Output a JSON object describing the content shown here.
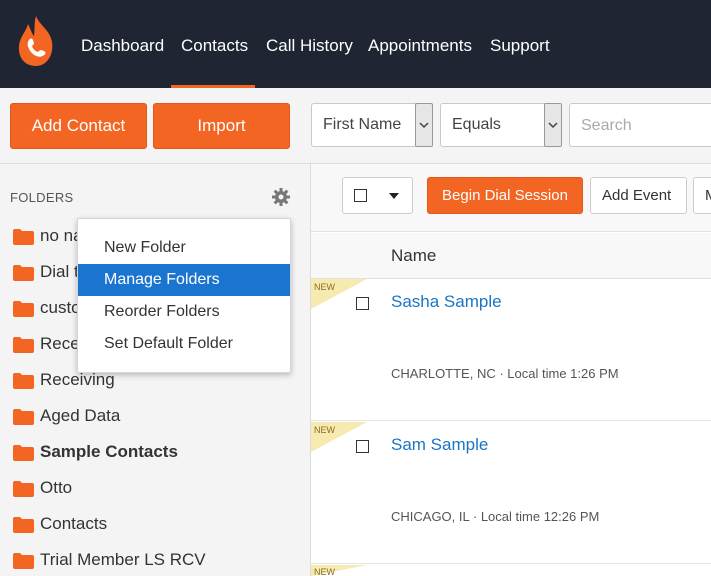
{
  "nav": {
    "items": [
      "Dashboard",
      "Contacts",
      "Call History",
      "Appointments",
      "Support"
    ],
    "active": "Contacts"
  },
  "actions": {
    "add_contact": "Add Contact",
    "import": "Import"
  },
  "filters": {
    "field": "First Name",
    "operator": "Equals",
    "search_placeholder": "Search"
  },
  "sidebar": {
    "title": "FOLDERS",
    "folders": [
      "no na",
      "Dial t",
      "custo",
      "Rece",
      "Receiving",
      "Aged Data",
      "Sample Contacts",
      "Otto",
      "Contacts",
      "Trial Member LS RCV"
    ],
    "bold_folder": "Sample Contacts"
  },
  "menu": {
    "items": [
      "New Folder",
      "Manage Folders",
      "Reorder Folders",
      "Set Default Folder"
    ],
    "highlighted": "Manage Folders"
  },
  "toolbar": {
    "dial": "Begin Dial Session",
    "add_event": "Add Event",
    "more": "M"
  },
  "table": {
    "column_name": "Name",
    "rows": [
      {
        "badge": "NEW",
        "name": "Sasha Sample",
        "location": "CHARLOTTE, NC",
        "local_time": "Local time 1:26 PM"
      },
      {
        "badge": "NEW",
        "name": "Sam Sample",
        "location": "CHICAGO, IL",
        "local_time": "Local time 12:26 PM"
      },
      {
        "badge": "NEW"
      }
    ]
  },
  "colors": {
    "brand_orange": "#f26522",
    "nav_bg": "#1f2533",
    "link_blue": "#1b75c4",
    "highlight_blue": "#1b75d0",
    "badge_yellow": "#f7eab0"
  }
}
